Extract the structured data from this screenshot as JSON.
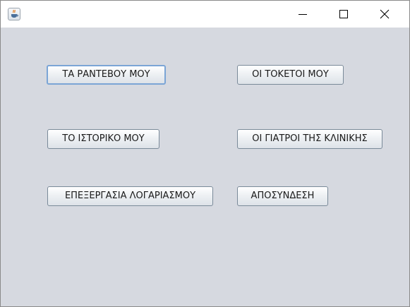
{
  "window": {
    "icon": "java-coffee-cup-icon",
    "controls": {
      "minimize": "minimize-icon",
      "maximize": "maximize-icon",
      "close": "close-icon"
    }
  },
  "buttons": {
    "my_appointments": "ΤΑ ΡΑΝΤΕΒΟΥ ΜΟΥ",
    "my_births": "ΟΙ ΤΟΚΕΤΟΙ ΜΟΥ",
    "my_history": "ΤΟ ΙΣΤΟΡΙΚΟ ΜΟΥ",
    "clinic_doctors": "ΟΙ ΓΙΑΤΡΟΙ ΤΗΣ ΚΛΙΝΙΚΗΣ",
    "account_editing": "ΕΠΕΞΕΡΓΑΣΙΑ ΛΟΓΑΡΙΑΣΜΟΥ",
    "logout": "ΑΠΟΣΥΝΔΕΣΗ"
  },
  "colors": {
    "content_background": "#d6d9e0",
    "focus_border": "#7ba5d6"
  }
}
